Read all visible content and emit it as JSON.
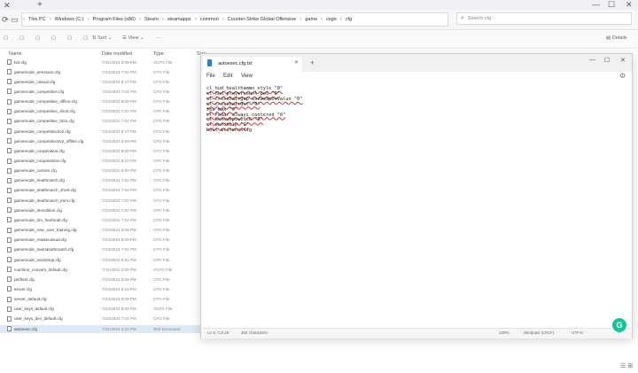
{
  "window_controls": {
    "minimize": "—",
    "maximize": "☐",
    "close": "✕"
  },
  "tab_add": "+",
  "nav": {
    "back": "←",
    "forward": "→",
    "up": "↑",
    "refresh": "⟳"
  },
  "breadcrumb": [
    "This PC",
    "Windows (C:)",
    "Program Files (x86)",
    "Steam",
    "steamapps",
    "common",
    "Counter-Strike Global Offensive",
    "game",
    "csgo",
    "cfg"
  ],
  "search_placeholder": "Search cfg",
  "toolbar": {
    "sort": "Sort",
    "view": "View",
    "more": "···",
    "details": "Details"
  },
  "columns": {
    "name": "Name",
    "date": "Date modified",
    "type": "Type",
    "size": "Size"
  },
  "files": [
    {
      "name": "bot.cfg",
      "date": "7/31/2024 3:09 PM",
      "type": "XCFG File"
    },
    {
      "name": "gamemode_armsrace.cfg",
      "date": "7/24/2024 7:04 PM",
      "type": "CFG File"
    },
    {
      "name": "gamemode_casual.cfg",
      "date": "7/24/2024 8:17 PM",
      "type": "CFG File"
    },
    {
      "name": "gamemode_competitive.cfg",
      "date": "7/24/2024 7:04 PM",
      "type": "CFG File"
    },
    {
      "name": "gamemode_competitive_offline.cfg",
      "date": "7/24/2024 8:09 PM",
      "type": "CFG File"
    },
    {
      "name": "gamemode_competitive_short.cfg",
      "date": "7/24/2024 7:04 PM",
      "type": "CFG File"
    },
    {
      "name": "gamemode_competitive_tmm.cfg",
      "date": "7/24/2024 7:04 PM",
      "type": "CFG File"
    },
    {
      "name": "gamemode_competitive2v2.cfg",
      "date": "7/24/2024 8:17 PM",
      "type": "CFG File"
    },
    {
      "name": "gamemode_competitive2v2_offline.cfg",
      "date": "7/24/2024 8:09 PM",
      "type": "CFG File"
    },
    {
      "name": "gamemode_cooperative.cfg",
      "date": "7/24/2024 8:09 PM",
      "type": "CFG File"
    },
    {
      "name": "gamemode_coopmission.cfg",
      "date": "7/24/2024 8:10 PM",
      "type": "CFG File"
    },
    {
      "name": "gamemode_custom.cfg",
      "date": "7/24/2024 8:09 PM",
      "type": "CFG File"
    },
    {
      "name": "gamemode_deathmatch.cfg",
      "date": "7/24/2024 7:04 PM",
      "type": "CFG File"
    },
    {
      "name": "gamemode_deathmatch_short.cfg",
      "date": "7/24/2024 7:04 PM",
      "type": "CFG File"
    },
    {
      "name": "gamemode_deathmatch_tmm.cfg",
      "date": "7/24/2024 7:04 PM",
      "type": "CFG File"
    },
    {
      "name": "gamemode_demolition.cfg",
      "date": "7/24/2024 7:04 PM",
      "type": "CFG File"
    },
    {
      "name": "gamemode_dm_freeforall.cfg",
      "date": "7/24/2024 7:04 PM",
      "type": "CFG File"
    },
    {
      "name": "gamemode_new_user_training.cfg",
      "date": "7/24/2024 8:09 PM",
      "type": "CFG File"
    },
    {
      "name": "gamemode_retakecasual.cfg",
      "date": "7/24/2024 8:09 PM",
      "type": "CFG File"
    },
    {
      "name": "gamemode_teamdeathmatch.cfg",
      "date": "7/24/2024 7:04 PM",
      "type": "CFG File"
    },
    {
      "name": "gamemode_workshop.cfg",
      "date": "7/24/2024 8:21 PM",
      "type": "CFG File"
    },
    {
      "name": "machine_convars_default.cfg",
      "date": "7/31/2024 3:09 PM",
      "type": "XCFG File"
    },
    {
      "name": "perftest.cfg",
      "date": "7/24/2024 8:09 PM",
      "type": "CFG File"
    },
    {
      "name": "server.cfg",
      "date": "7/24/2024 8:10 PM",
      "type": "CFG File"
    },
    {
      "name": "server_default.cfg",
      "date": "7/24/2024 8:09 PM",
      "type": "CFG File"
    },
    {
      "name": "user_keys_default.cfg",
      "date": "7/24/2024 8:09 PM",
      "type": "XCFG File"
    },
    {
      "name": "user_keys_dev_default.cfg",
      "date": "7/24/2024 7:04 PM",
      "type": "CFG File"
    },
    {
      "name": "autoexec.cfg",
      "date": "7/31/2024 4:23 PM",
      "type": "Text Document"
    }
  ],
  "notepad": {
    "tab_title": "autoexec.cfg.txt",
    "tab_close": "✕",
    "tab_add": "+",
    "menu": [
      "File",
      "Edit",
      "View"
    ],
    "settings_icon": "⚙",
    "lines": [
      {
        "text": "cl_hud_healthammo_style \"0\"",
        "err": true
      },
      {
        "text": "cl_hud_playercount_pos \"0\"",
        "err": true
      },
      {
        "text": "cl_crosshairgap_useweaponvalue \"0\"",
        "err": true
      },
      {
        "text": "cl_crosshairdot \"0\"",
        "err": true
      },
      {
        "text": "fps_max \"0\"",
        "err": true
      },
      {
        "text": "cl_radar_always_centered \"0\"",
        "err": true
      },
      {
        "text": "cl_autowepswitch \"0\"",
        "err": true
      },
      {
        "text": "cl_autohelp \"1\"",
        "err": true
      },
      {
        "text": "host_writeconfig",
        "err": false
      }
    ],
    "status": {
      "position": "Ln 9, Col 29",
      "chars": "264 characters",
      "zoom": "100%",
      "eol": "Windows (CRLF)",
      "encoding": "UTF-8"
    },
    "grammarly_label": "G"
  },
  "view_toggle": {
    "details": "☰",
    "tiles": "⊞"
  }
}
